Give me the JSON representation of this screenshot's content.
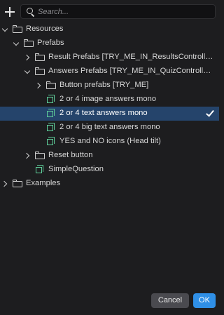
{
  "search": {
    "placeholder": "Search..."
  },
  "tree": [
    {
      "label": "Resources",
      "kind": "folder",
      "depth": 0,
      "expanded": true,
      "has_children": true
    },
    {
      "label": "Prefabs",
      "kind": "folder",
      "depth": 1,
      "expanded": true,
      "has_children": true
    },
    {
      "label": "Result Prefabs [TRY_ME_IN_ResultsControll…",
      "kind": "folder",
      "depth": 2,
      "expanded": false,
      "has_children": true
    },
    {
      "label": "Answers Prefabs [TRY_ME_IN_QuizControll…",
      "kind": "folder",
      "depth": 2,
      "expanded": true,
      "has_children": true
    },
    {
      "label": "Button prefabs [TRY_ME]",
      "kind": "folder",
      "depth": 3,
      "expanded": false,
      "has_children": true
    },
    {
      "label": "2 or 4 image answers mono",
      "kind": "prefab",
      "depth": 3,
      "has_children": false
    },
    {
      "label": "2 or 4 text answers mono",
      "kind": "prefab",
      "depth": 3,
      "has_children": false,
      "selected": true
    },
    {
      "label": "2 or 4 big text answers mono",
      "kind": "prefab",
      "depth": 3,
      "has_children": false
    },
    {
      "label": "YES and NO icons (Head tilt)",
      "kind": "prefab",
      "depth": 3,
      "has_children": false
    },
    {
      "label": "Reset button",
      "kind": "folder",
      "depth": 2,
      "expanded": false,
      "has_children": true
    },
    {
      "label": "SimpleQuestion",
      "kind": "prefab",
      "depth": 2,
      "has_children": false
    },
    {
      "label": "Examples",
      "kind": "folder",
      "depth": 0,
      "expanded": false,
      "has_children": true
    }
  ],
  "footer": {
    "cancel_label": "Cancel",
    "ok_label": "OK"
  },
  "colors": {
    "selection": "#25446b",
    "prefab_icon": "#5fcf9a",
    "ok_button": "#2f8fe6"
  }
}
